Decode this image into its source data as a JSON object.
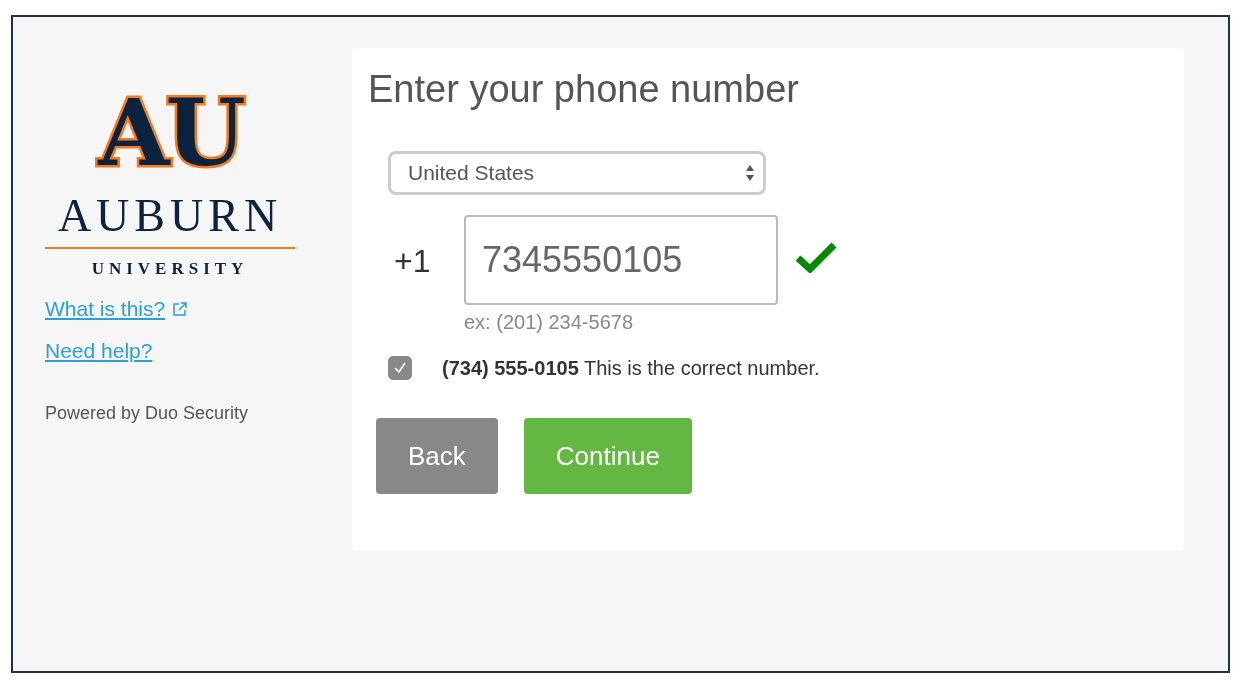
{
  "logo": {
    "monogram": "AU",
    "name": "AUBURN",
    "subtitle": "UNIVERSITY"
  },
  "links": [
    {
      "label": "What is this?",
      "external": true
    },
    {
      "label": "Need help?",
      "external": false
    }
  ],
  "powered_by": "Powered by Duo Security",
  "form": {
    "title": "Enter your phone number",
    "country": {
      "value": "United States"
    },
    "prefix": "+1",
    "phone": {
      "value": "7345550105",
      "valid": true
    },
    "example": "ex: (201) 234-5678",
    "confirm": {
      "label": "**(734) 555-0105** This is the correct number.",
      "checked": true
    },
    "buttons": [
      {
        "label": "Back",
        "kind": "secondary"
      },
      {
        "label": "Continue",
        "kind": "primary"
      }
    ]
  }
}
